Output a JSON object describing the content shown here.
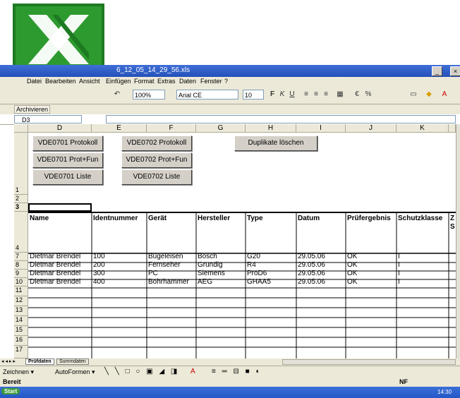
{
  "window": {
    "title": "6_12_05_14_29_56.xls",
    "title_controls": [
      "_",
      "×"
    ]
  },
  "menu": {
    "items": [
      "Datei",
      "Bearbeiten",
      "Ansicht",
      "Einfügen",
      "Format",
      "Extras",
      "Daten",
      "Fenster",
      "?"
    ]
  },
  "toolbar": {
    "zoom": "100%",
    "font": "Arial CE",
    "font_size": "10",
    "bold": "F",
    "italic": "K",
    "underline": "U"
  },
  "archive_bar": {
    "label": "Archivieren"
  },
  "namebox": {
    "value": "D3"
  },
  "columns": [
    "D",
    "E",
    "F",
    "G",
    "H",
    "I",
    "J",
    "K"
  ],
  "buttons": [
    {
      "label": "VDE0701 Protokoll"
    },
    {
      "label": "VDE0702 Protokoll"
    },
    {
      "label": "Duplikate löschen"
    },
    {
      "label": "VDE0701 Prot+Fun"
    },
    {
      "label": "VDE0702 Prot+Fun"
    },
    {
      "label": "VDE0701 Liste"
    },
    {
      "label": "VDE0702 Liste"
    }
  ],
  "row_numbers": [
    "1",
    "2",
    "3",
    "4",
    "7",
    "8",
    "9",
    "10",
    "11",
    "12",
    "13",
    "14",
    "15",
    "16",
    "17"
  ],
  "table": {
    "headers": [
      "Name",
      "Identnummer",
      "Gerät",
      "Hersteller",
      "Type",
      "Datum",
      "Prüfergebnis",
      "Schutzklasse",
      "Z S"
    ],
    "rows": [
      [
        "Dietmar Brendel",
        "100",
        "Bügeleisen",
        "Bosch",
        "G20",
        "29.05.06",
        "OK",
        "I"
      ],
      [
        "Dietmar Brendel",
        "200",
        "Fernseher",
        "Grundig",
        "R4",
        "29.05.06",
        "OK",
        "I"
      ],
      [
        "Dietmar Brendel",
        "300",
        "PC",
        "Siemens",
        "ProD6",
        "29.05.06",
        "OK",
        "I"
      ],
      [
        "Dietmar Brendel",
        "400",
        "Bohrhammer",
        "AEG",
        "GHAA5",
        "29.05.06",
        "OK",
        "I"
      ]
    ]
  },
  "sheet_tabs": [
    "Prüfdaten",
    "Summdaten"
  ],
  "drawbar": {
    "zeichnen": "Zeichnen ▾",
    "autoformen": "AutoFormen ▾"
  },
  "status": {
    "left": "Bereit",
    "right": "NF"
  },
  "taskbar": {
    "start": "Start",
    "clock": "14:30"
  }
}
